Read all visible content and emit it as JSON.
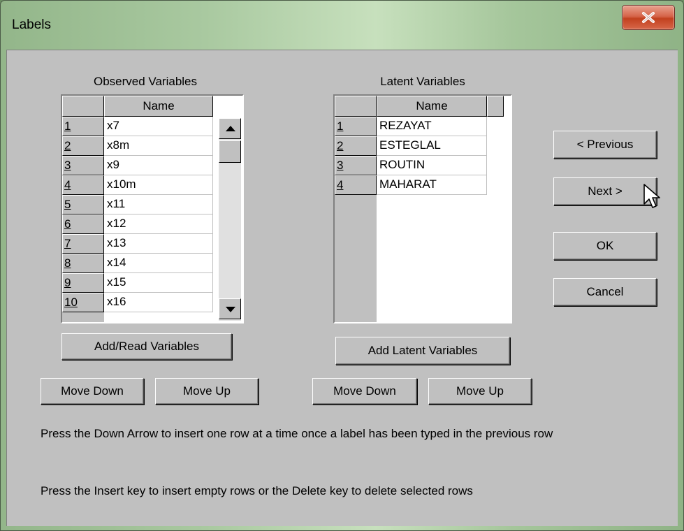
{
  "window": {
    "title": "Labels"
  },
  "observed": {
    "caption": "Observed Variables",
    "header": "Name",
    "rows": [
      {
        "num": "1",
        "name": "x7"
      },
      {
        "num": "2",
        "name": "x8m"
      },
      {
        "num": "3",
        "name": "x9"
      },
      {
        "num": "4",
        "name": "x10m"
      },
      {
        "num": "5",
        "name": "x11"
      },
      {
        "num": "6",
        "name": "x12"
      },
      {
        "num": "7",
        "name": "x13"
      },
      {
        "num": "8",
        "name": "x14"
      },
      {
        "num": "9",
        "name": "x15"
      },
      {
        "num": "10",
        "name": "x16"
      }
    ],
    "add_button": "Add/Read Variables",
    "move_down": "Move Down",
    "move_up": "Move Up"
  },
  "latent": {
    "caption": "Latent Variables",
    "header": "Name",
    "rows": [
      {
        "num": "1",
        "name": "REZAYAT"
      },
      {
        "num": "2",
        "name": "ESTEGLAL"
      },
      {
        "num": "3",
        "name": "ROUTIN"
      },
      {
        "num": "4",
        "name": "MAHARAT"
      }
    ],
    "add_button": "Add Latent Variables",
    "move_down": "Move Down",
    "move_up": "Move Up"
  },
  "nav": {
    "previous": "< Previous",
    "next": "Next >",
    "ok": "OK",
    "cancel": "Cancel"
  },
  "help": {
    "line1": "Press the Down Arrow to insert one row at a time once a label has been typed in the previous row",
    "line2": "Press the Insert key to insert empty rows or the Delete key to delete selected rows"
  }
}
